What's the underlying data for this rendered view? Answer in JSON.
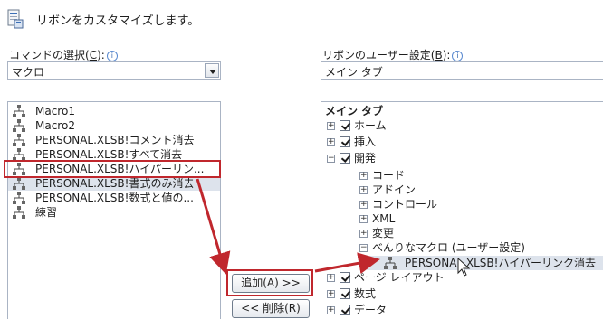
{
  "header": {
    "title": "リボンをカスタマイズします。",
    "icon": "ribbon-customize-icon"
  },
  "left": {
    "label_prefix": "コマンドの選択(",
    "label_key": "C",
    "label_suffix": "):",
    "dropdown_value": "マクロ",
    "items": [
      {
        "text": "Macro1"
      },
      {
        "text": "Macro2"
      },
      {
        "text": "PERSONAL.XLSB!コメント消去"
      },
      {
        "text": "PERSONAL.XLSB!すべて消去"
      },
      {
        "text": "PERSONAL.XLSB!ハイパーリン..."
      },
      {
        "text": "PERSONAL.XLSB!書式のみ消去"
      },
      {
        "text": "PERSONAL.XLSB!数式と値の..."
      },
      {
        "text": "練習"
      }
    ]
  },
  "buttons": {
    "add": "追加(A) >>",
    "remove": "<< 削除(R)"
  },
  "right": {
    "label_prefix": "リボンのユーザー設定(",
    "label_key": "B",
    "label_suffix": "):",
    "dropdown_value": "メイン タブ",
    "tree_header": "メイン タブ",
    "tabs": [
      {
        "label": "ホーム"
      },
      {
        "label": "挿入"
      },
      {
        "label": "開発"
      }
    ],
    "dev_groups": [
      {
        "label": "コード"
      },
      {
        "label": "アドイン"
      },
      {
        "label": "コントロール"
      },
      {
        "label": "XML"
      },
      {
        "label": "変更"
      }
    ],
    "custom_group": "べんりなマクロ (ユーザー設定)",
    "dragged_item": "PERSONAL.XLSB!ハイパーリンク消去",
    "tabs_after": [
      {
        "label": "ページ レイアウト"
      },
      {
        "label": "数式"
      },
      {
        "label": "データ"
      }
    ]
  },
  "colors": {
    "highlight": "#c0272d",
    "selection": "#dde3ec"
  }
}
